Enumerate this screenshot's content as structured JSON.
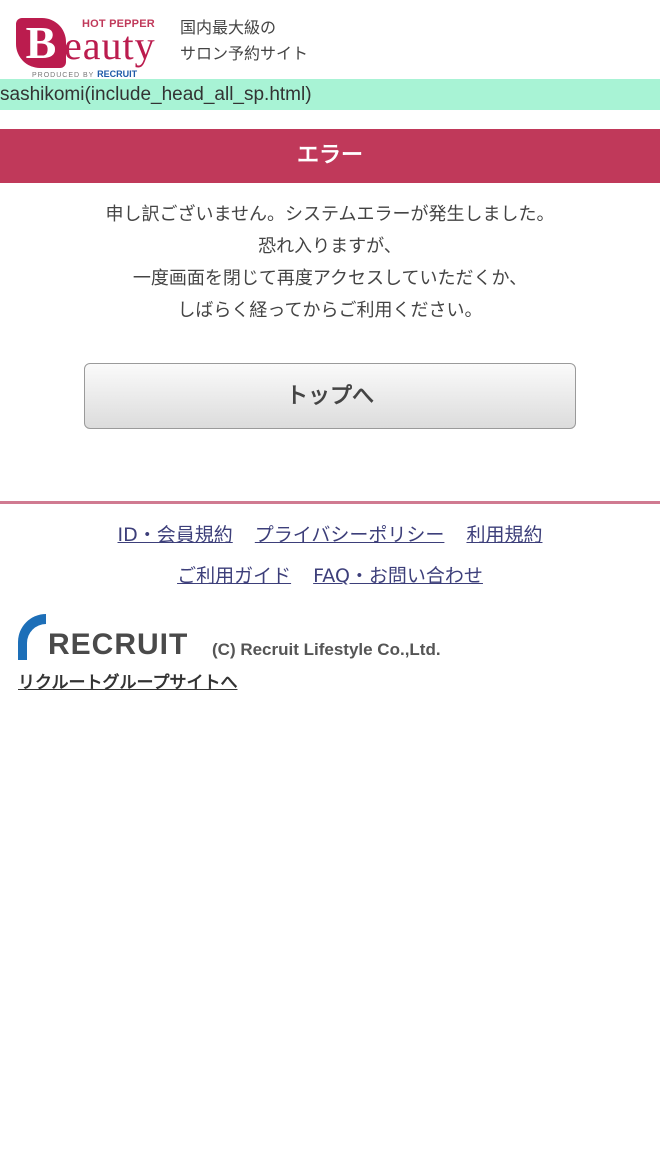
{
  "header": {
    "logo": {
      "brand_top": "HOT PEPPER",
      "brand_initial": "B",
      "brand_rest": "eauty",
      "produced_by": "PRODUCED BY",
      "produced_by_company": "RECRUIT"
    },
    "tagline_line1": "国内最大級の",
    "tagline_line2": "サロン予約サイト"
  },
  "sashikomi": "sashikomi(include_head_all_sp.html)",
  "error": {
    "title": "エラー",
    "message_lines": [
      "申し訳ございません。システムエラーが発生しました。",
      "恐れ入りますが、",
      "一度画面を閉じて再度アクセスしていただくか、",
      "しばらく経ってからご利用ください。"
    ],
    "top_button": "トップへ"
  },
  "footer": {
    "links_row1": [
      "ID・会員規約",
      "プライバシーポリシー",
      "利用規約"
    ],
    "links_row2": [
      "ご利用ガイド",
      "FAQ・お問い合わせ"
    ],
    "recruit_logo_text": "RECRUIT",
    "copyright": "(C) Recruit Lifestyle Co.,Ltd.",
    "group_link": "リクルートグループサイトへ"
  },
  "colors": {
    "brand": "#bb1c4e",
    "error_bar": "#c0395a",
    "sashikomi_bg": "#a8f3d5",
    "link": "#3d3f7a",
    "recruit_blue": "#1d6fb8"
  }
}
